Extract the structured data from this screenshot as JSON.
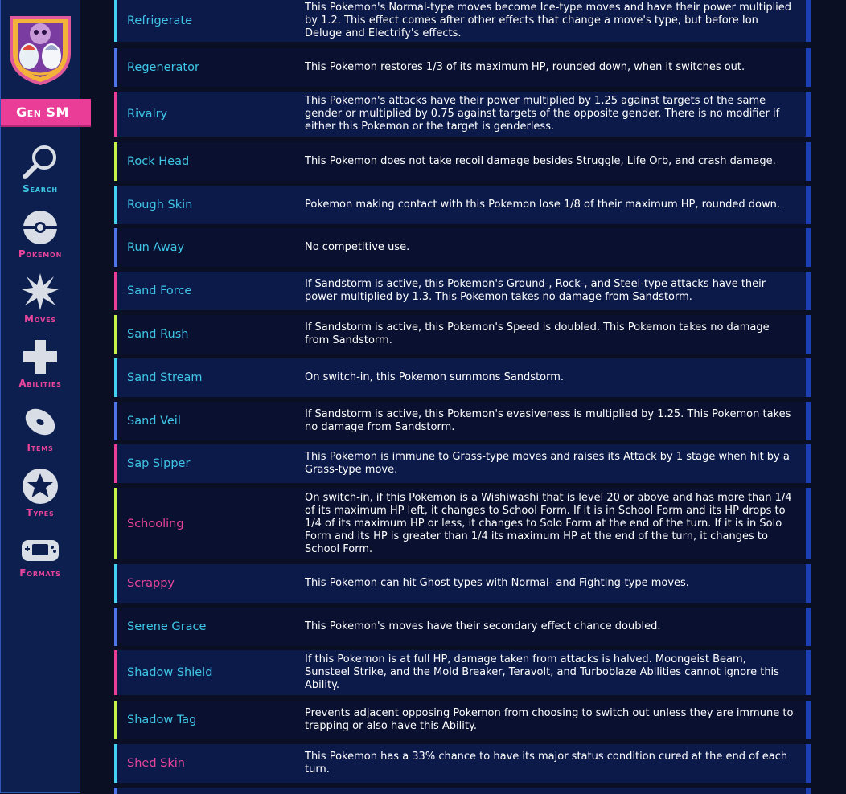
{
  "sidebar": {
    "gen_label": "Gen SM",
    "nav": [
      {
        "label": "Search",
        "icon": "search-icon",
        "color": "#3fc6e6"
      },
      {
        "label": "Pokemon",
        "icon": "pokeball-icon",
        "color": "#e8449a"
      },
      {
        "label": "Moves",
        "icon": "burst-icon",
        "color": "#e8449a"
      },
      {
        "label": "Abilities",
        "icon": "plus-icon",
        "color": "#e8449a"
      },
      {
        "label": "Items",
        "icon": "disc-icon",
        "color": "#e8449a"
      },
      {
        "label": "Types",
        "icon": "star-icon",
        "color": "#e8449a"
      },
      {
        "label": "Formats",
        "icon": "gameboy-icon",
        "color": "#e8449a"
      }
    ]
  },
  "colors": {
    "accent_cyan": "#42d3f0",
    "accent_blue": "#4f73e8",
    "accent_pink": "#ea3d97",
    "accent_lime": "#c6f24a"
  },
  "abilities": [
    {
      "name": "Refrigerate",
      "name_color": "#3fc6e6",
      "border": "#42d3f0",
      "desc": "This Pokemon's Normal-type moves become Ice-type moves and have their power multiplied by 1.2. This effect comes after other effects that change a move's type, but before Ion Deluge and Electrify's effects."
    },
    {
      "name": "Regenerator",
      "name_color": "#3fc6e6",
      "border": "#4f73e8",
      "desc": "This Pokemon restores 1/3 of its maximum HP, rounded down, when it switches out."
    },
    {
      "name": "Rivalry",
      "name_color": "#3fc6e6",
      "border": "#ea3d97",
      "desc": "This Pokemon's attacks have their power multiplied by 1.25 against targets of the same gender or multiplied by 0.75 against targets of the opposite gender. There is no modifier if either this Pokemon or the target is genderless."
    },
    {
      "name": "Rock Head",
      "name_color": "#3fc6e6",
      "border": "#c6f24a",
      "desc": "This Pokemon does not take recoil damage besides Struggle, Life Orb, and crash damage."
    },
    {
      "name": "Rough Skin",
      "name_color": "#3fc6e6",
      "border": "#42d3f0",
      "desc": "Pokemon making contact with this Pokemon lose 1/8 of their maximum HP, rounded down."
    },
    {
      "name": "Run Away",
      "name_color": "#3fc6e6",
      "border": "#4f73e8",
      "desc": "No competitive use."
    },
    {
      "name": "Sand Force",
      "name_color": "#3fc6e6",
      "border": "#ea3d97",
      "desc": "If Sandstorm is active, this Pokemon's Ground-, Rock-, and Steel-type attacks have their power multiplied by 1.3. This Pokemon takes no damage from Sandstorm."
    },
    {
      "name": "Sand Rush",
      "name_color": "#3fc6e6",
      "border": "#c6f24a",
      "desc": "If Sandstorm is active, this Pokemon's Speed is doubled. This Pokemon takes no damage from Sandstorm."
    },
    {
      "name": "Sand Stream",
      "name_color": "#3fc6e6",
      "border": "#42d3f0",
      "desc": "On switch-in, this Pokemon summons Sandstorm."
    },
    {
      "name": "Sand Veil",
      "name_color": "#3fc6e6",
      "border": "#4f73e8",
      "desc": "If Sandstorm is active, this Pokemon's evasiveness is multiplied by 1.25. This Pokemon takes no damage from Sandstorm."
    },
    {
      "name": "Sap Sipper",
      "name_color": "#3fc6e6",
      "border": "#ea3d97",
      "desc": "This Pokemon is immune to Grass-type moves and raises its Attack by 1 stage when hit by a Grass-type move."
    },
    {
      "name": "Schooling",
      "name_color": "#e8449a",
      "border": "#c6f24a",
      "desc": "On switch-in, if this Pokemon is a Wishiwashi that is level 20 or above and has more than 1/4 of its maximum HP left, it changes to School Form. If it is in School Form and its HP drops to 1/4 of its maximum HP or less, it changes to Solo Form at the end of the turn. If it is in Solo Form and its HP is greater than 1/4 its maximum HP at the end of the turn, it changes to School Form."
    },
    {
      "name": "Scrappy",
      "name_color": "#e8449a",
      "border": "#42d3f0",
      "desc": "This Pokemon can hit Ghost types with Normal- and Fighting-type moves."
    },
    {
      "name": "Serene Grace",
      "name_color": "#3fc6e6",
      "border": "#4f73e8",
      "desc": "This Pokemon's moves have their secondary effect chance doubled."
    },
    {
      "name": "Shadow Shield",
      "name_color": "#3fc6e6",
      "border": "#ea3d97",
      "desc": "If this Pokemon is at full HP, damage taken from attacks is halved. Moongeist Beam, Sunsteel Strike, and the Mold Breaker, Teravolt, and Turboblaze Abilities cannot ignore this Ability."
    },
    {
      "name": "Shadow Tag",
      "name_color": "#3fc6e6",
      "border": "#c6f24a",
      "desc": "Prevents adjacent opposing Pokemon from choosing to switch out unless they are immune to trapping or also have this Ability."
    },
    {
      "name": "Shed Skin",
      "name_color": "#e8449a",
      "border": "#42d3f0",
      "desc": "This Pokemon has a 33% chance to have its major status condition cured at the end of each turn."
    }
  ]
}
